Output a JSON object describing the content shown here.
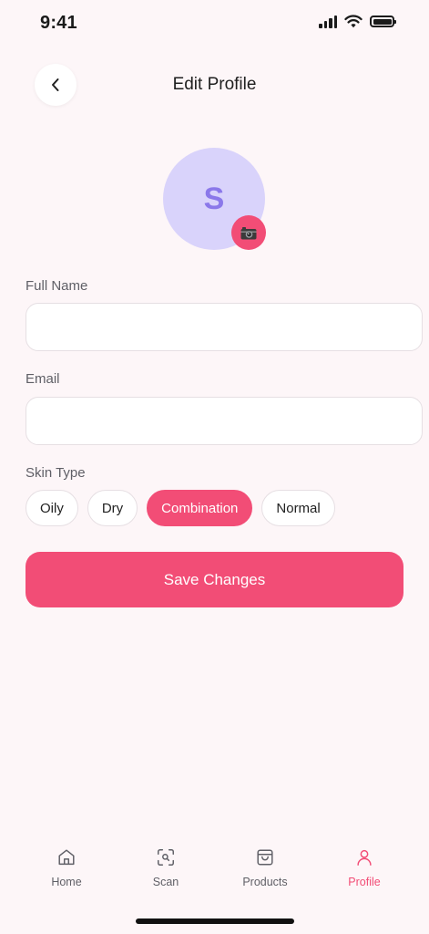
{
  "status_bar": {
    "time": "9:41"
  },
  "header": {
    "title": "Edit Profile"
  },
  "avatar": {
    "initial": "S"
  },
  "form": {
    "full_name": {
      "label": "Full Name",
      "value": "",
      "placeholder": ""
    },
    "email": {
      "label": "Email",
      "value": "",
      "placeholder": ""
    },
    "skin_type": {
      "label": "Skin Type",
      "options": [
        "Oily",
        "Dry",
        "Combination",
        "Normal"
      ],
      "selected": "Combination"
    },
    "save_label": "Save Changes"
  },
  "nav": {
    "items": [
      {
        "label": "Home",
        "icon": "home-icon"
      },
      {
        "label": "Scan",
        "icon": "scan-icon"
      },
      {
        "label": "Products",
        "icon": "shopping-bag-icon"
      },
      {
        "label": "Profile",
        "icon": "user-icon"
      }
    ],
    "active": "Profile"
  },
  "colors": {
    "accent": "#f24d76",
    "avatar_bg": "#d9d3fb",
    "avatar_text": "#8b78ea",
    "background": "#fdf6f8"
  }
}
